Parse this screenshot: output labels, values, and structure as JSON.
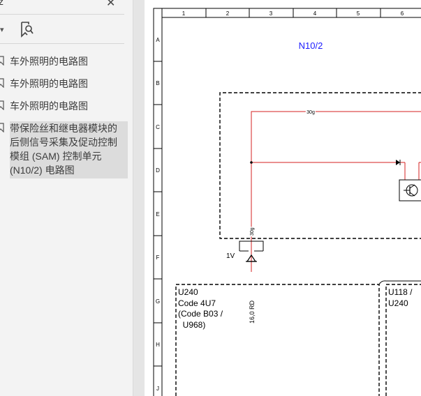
{
  "sidebar": {
    "title": "z",
    "close_icon": "✕",
    "dropdown_icon": "▾",
    "bookmarks": [
      {
        "label": "车外照明的电路图"
      },
      {
        "label": "车外照明的电路图"
      },
      {
        "label": "车外照明的电路图"
      },
      {
        "lines": [
          "带保险丝和继电器模块的",
          "后侧信号采集及促动控制",
          "模组 (SAM) 控制单元",
          "(N10/2) 电路图"
        ],
        "selected": true
      }
    ]
  },
  "diagram": {
    "columns": [
      "1",
      "2",
      "3",
      "4",
      "5",
      "6"
    ],
    "rows": [
      "A",
      "B",
      "C",
      "D",
      "E",
      "F",
      "G",
      "H",
      "J"
    ],
    "module_label": "N10/2",
    "wire_top_label": "30g",
    "wire_vertical_label": "30g",
    "voltage_label": "1V",
    "wire_code": "16,0 RD",
    "box_left": [
      "U240",
      "Code 4U7",
      "(Code B03  /",
      "  U968)"
    ],
    "box_right": [
      "U118 /",
      "U240"
    ],
    "colors": {
      "wire": "#d42020",
      "module_label": "#1a1aff"
    }
  }
}
